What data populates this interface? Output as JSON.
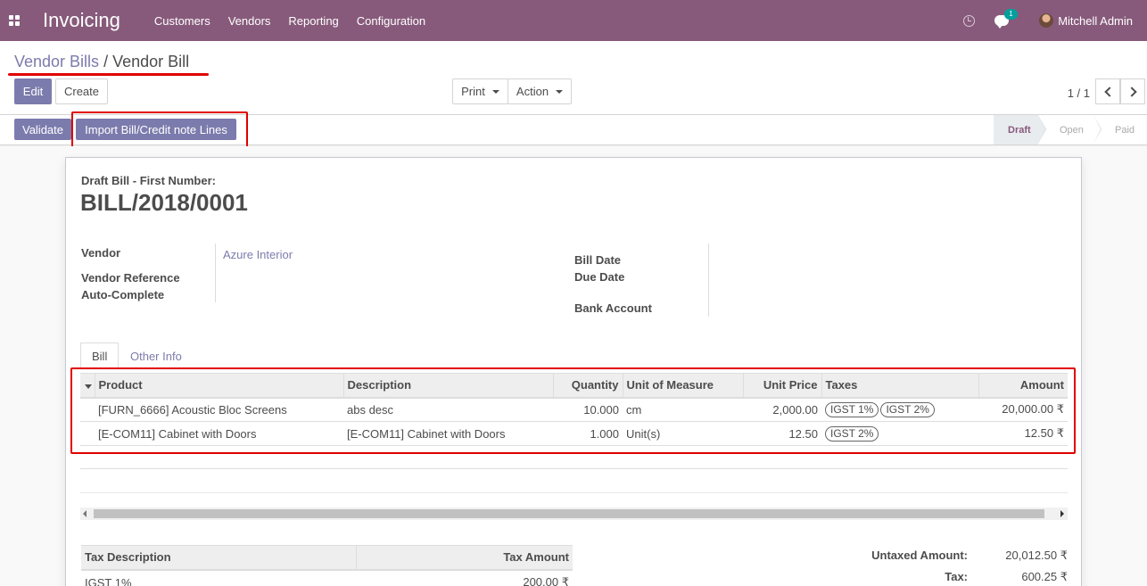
{
  "navbar": {
    "app_title": "Invoicing",
    "menu": [
      "Customers",
      "Vendors",
      "Reporting",
      "Configuration"
    ],
    "chat_count": "1",
    "user_name": "Mitchell Admin"
  },
  "breadcrumb": {
    "parent": "Vendor Bills",
    "separator": "/",
    "current": "Vendor Bill"
  },
  "actions": {
    "edit": "Edit",
    "create": "Create",
    "print": "Print",
    "action": "Action",
    "pager": "1 / 1"
  },
  "statusbar": {
    "validate": "Validate",
    "import_lines": "Import Bill/Credit note Lines",
    "steps": [
      "Draft",
      "Open",
      "Paid"
    ],
    "active_step": "Draft"
  },
  "bill": {
    "draft_label": "Draft Bill  - First Number:",
    "number": "BILL/2018/0001",
    "vendor_label": "Vendor",
    "vendor_value": "Azure Interior",
    "vendor_reference_label": "Vendor Reference",
    "auto_complete_label": "Auto-Complete",
    "bill_date_label": "Bill Date",
    "due_date_label": "Due Date",
    "bank_account_label": "Bank Account"
  },
  "tabs": [
    "Bill",
    "Other Info"
  ],
  "lines": {
    "headers": [
      "Product",
      "Description",
      "Quantity",
      "Unit of Measure",
      "Unit Price",
      "Taxes",
      "Amount"
    ],
    "rows": [
      {
        "product": "[FURN_6666] Acoustic Bloc Screens",
        "description": "abs desc",
        "quantity": "10.000",
        "uom": "cm",
        "unit_price": "2,000.00",
        "taxes": [
          "IGST 1%",
          "IGST 2%"
        ],
        "amount": "20,000.00 ₹"
      },
      {
        "product": "[E-COM11] Cabinet with Doors",
        "description": "[E-COM11] Cabinet with Doors",
        "quantity": "1.000",
        "uom": "Unit(s)",
        "unit_price": "12.50",
        "taxes": [
          "IGST 2%"
        ],
        "amount": "12.50 ₹"
      }
    ]
  },
  "tax_table": {
    "headers": [
      "Tax Description",
      "Tax Amount"
    ],
    "rows": [
      {
        "description": "IGST 1%",
        "amount": "200.00 ₹"
      }
    ]
  },
  "totals": {
    "untaxed_label": "Untaxed Amount:",
    "untaxed_value": "20,012.50 ₹",
    "tax_label": "Tax:",
    "tax_value": "600.25 ₹"
  }
}
